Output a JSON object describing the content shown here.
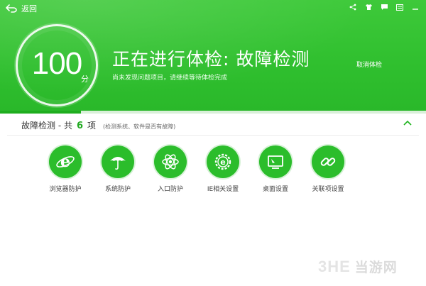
{
  "header": {
    "back_label": "返回",
    "score": "100",
    "score_unit": "分",
    "title": "正在进行体检: 故障检测",
    "subtitle": "尚未发现问题项目，请继续等待体检完成",
    "cancel_label": "取消体检",
    "window_controls": [
      "share-icon",
      "shirt-icon",
      "message-icon",
      "menu-icon",
      "minimize-icon"
    ]
  },
  "progress": {
    "fraction": 0.19
  },
  "section": {
    "title": "故障检测 - 共",
    "count": "6",
    "count_suffix": "项",
    "hint": "(检测系统、软件是否有故障)",
    "collapse_icon": "chevron-up-icon"
  },
  "items": [
    {
      "label": "浏览器防护",
      "icon": "ie-browser-icon"
    },
    {
      "label": "系统防护",
      "icon": "umbrella-icon"
    },
    {
      "label": "入口防护",
      "icon": "atom-icon"
    },
    {
      "label": "IE相关设置",
      "icon": "ie-settings-icon"
    },
    {
      "label": "桌面设置",
      "icon": "desktop-icon"
    },
    {
      "label": "关联项设置",
      "icon": "link-icon"
    }
  ],
  "watermark": {
    "logo": "3HE",
    "text": "当游网"
  },
  "colors": {
    "header_green": "#2fbf2e",
    "accent_green": "#22aa22",
    "icon_green": "#2bbd2b"
  }
}
